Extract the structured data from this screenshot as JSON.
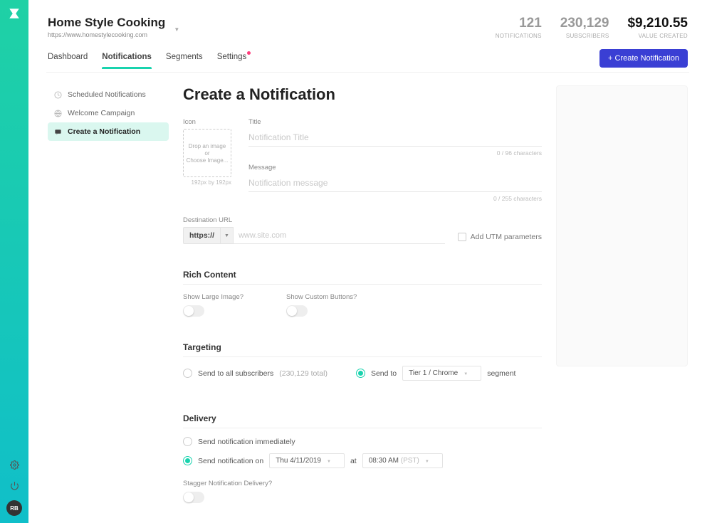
{
  "site": {
    "name": "Home Style Cooking",
    "url": "https://www.homestylecooking.com"
  },
  "stats": {
    "notifications": {
      "value": "121",
      "label": "NOTIFICATIONS"
    },
    "subscribers": {
      "value": "230,129",
      "label": "SUBSCRIBERS"
    },
    "value_created": {
      "value": "$9,210.55",
      "label": "VALUE CREATED"
    }
  },
  "nav": {
    "dashboard": "Dashboard",
    "notifications": "Notifications",
    "segments": "Segments",
    "settings": "Settings"
  },
  "create_button": "+ Create Notification",
  "subnav": {
    "scheduled": "Scheduled Notifications",
    "welcome": "Welcome Campaign",
    "create": "Create a Notification"
  },
  "page_title": "Create a Notification",
  "icon_field": {
    "label": "Icon",
    "drop_line1": "Drop an image",
    "or": "or",
    "choose": "Choose Image...",
    "dims": "192px by 192px"
  },
  "title_field": {
    "label": "Title",
    "placeholder": "Notification Title",
    "count": "0 / 96 characters"
  },
  "message_field": {
    "label": "Message",
    "placeholder": "Notification message",
    "count": "0 / 255 characters"
  },
  "dest": {
    "label": "Destination URL",
    "scheme": "https://",
    "placeholder": "www.site.com",
    "utm_label": "Add UTM parameters"
  },
  "rich": {
    "heading": "Rich Content",
    "large_image": "Show Large Image?",
    "custom_buttons": "Show Custom Buttons?"
  },
  "targeting": {
    "heading": "Targeting",
    "all_label": "Send to all subscribers",
    "all_count": "(230,129 total)",
    "segment_prefix": "Send to",
    "segment_value": "Tier 1 / Chrome",
    "segment_suffix": "segment"
  },
  "delivery": {
    "heading": "Delivery",
    "immediate": "Send notification immediately",
    "scheduled_prefix": "Send notification on",
    "date": "Thu 4/11/2019",
    "at": "at",
    "time": "08:30 AM",
    "tz": "(PST)",
    "stagger_label": "Stagger Notification Delivery?"
  },
  "avatar_initials": "RB"
}
